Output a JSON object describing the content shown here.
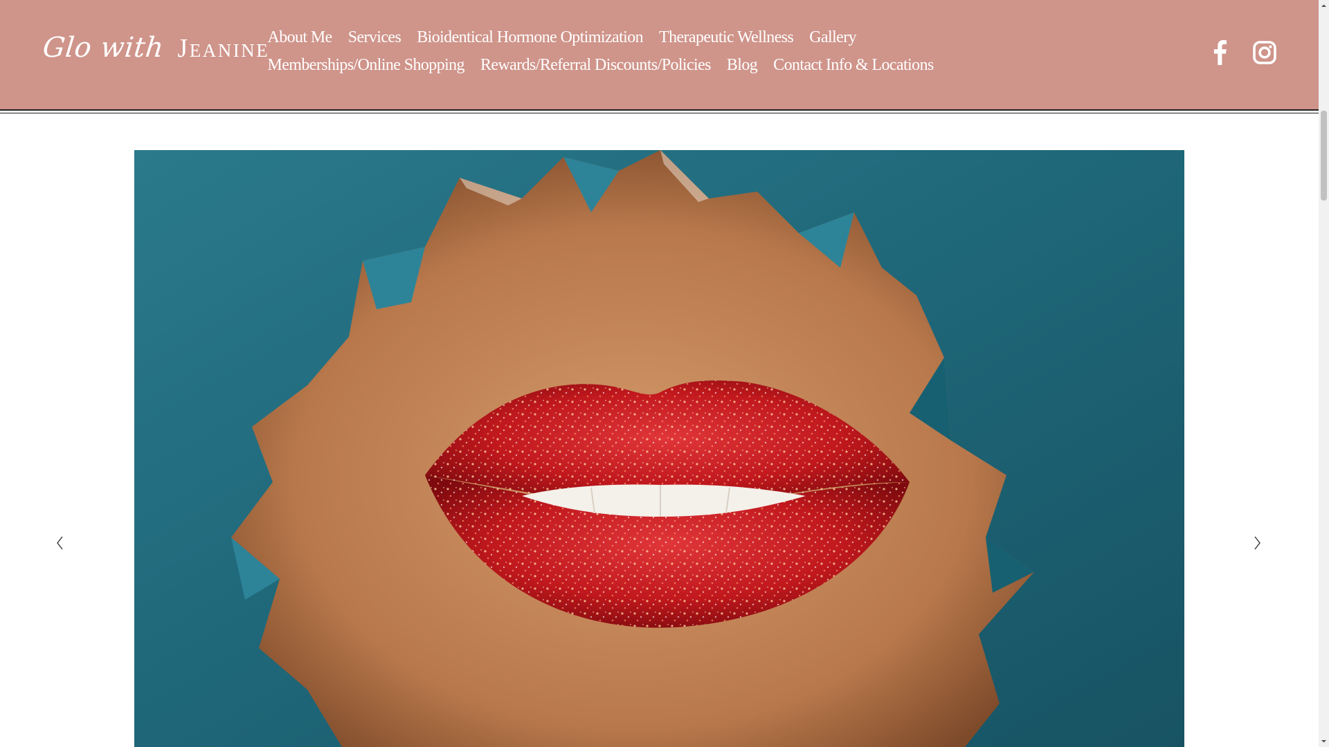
{
  "brand": {
    "logo_script": "Glo with",
    "logo_caps": "Jeanine",
    "header_color": "#cf948a"
  },
  "nav": {
    "items": [
      {
        "label": "About Me"
      },
      {
        "label": "Services"
      },
      {
        "label": "Bioidentical Hormone Optimization"
      },
      {
        "label": "Therapeutic Wellness"
      },
      {
        "label": "Gallery"
      },
      {
        "label": "Memberships/Online Shopping"
      },
      {
        "label": "Rewards/Referral Discounts/Policies"
      },
      {
        "label": "Blog"
      },
      {
        "label": "Contact Info & Locations"
      }
    ]
  },
  "social": {
    "icons": [
      "facebook-icon",
      "instagram-icon"
    ]
  },
  "hero": {
    "image": "torn-teal-paper-red-glitter-lips",
    "colors": {
      "paper": "#1f6a7c",
      "lips": "#c4161c",
      "skin": "#c98a5c"
    }
  },
  "slideshow": {
    "prev_icon": "chevron-left-icon",
    "next_icon": "chevron-right-icon"
  }
}
